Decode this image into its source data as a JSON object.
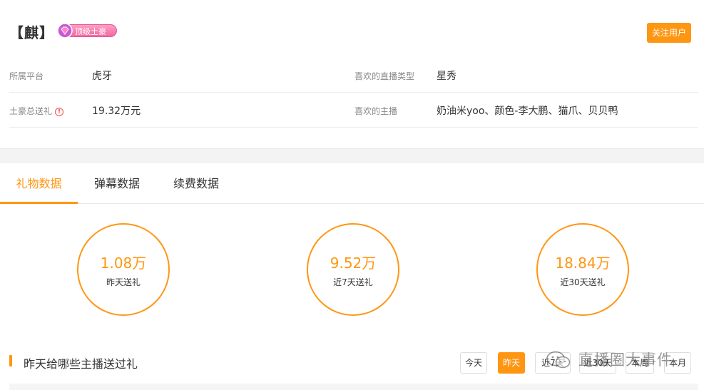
{
  "user": {
    "name": "【麒】",
    "badge_label": "顶级土豪",
    "follow_label": "关注用户"
  },
  "info": {
    "platform_label": "所属平台",
    "platform_value": "虎牙",
    "favorite_type_label": "喜欢的直播类型",
    "favorite_type_value": "星秀",
    "total_gift_label": "土豪总送礼",
    "total_gift_value": "19.32万元",
    "favorite_anchor_label": "喜欢的主播",
    "favorite_anchor_value": "奶油米yoo、颜色-李大鹏、猫爪、贝贝鸭"
  },
  "tabs": [
    {
      "label": "礼物数据",
      "active": true
    },
    {
      "label": "弹幕数据",
      "active": false
    },
    {
      "label": "续费数据",
      "active": false
    }
  ],
  "stats": [
    {
      "value": "1.08万",
      "caption": "昨天送礼"
    },
    {
      "value": "9.52万",
      "caption": "近7天送礼"
    },
    {
      "value": "18.84万",
      "caption": "近30天送礼"
    }
  ],
  "section": {
    "title": "昨天给哪些主播送过礼"
  },
  "ranges": [
    {
      "label": "今天",
      "active": false
    },
    {
      "label": "昨天",
      "active": true
    },
    {
      "label": "近7天",
      "active": false
    },
    {
      "label": "近30天",
      "active": false
    },
    {
      "label": "本周",
      "active": false
    },
    {
      "label": "本月",
      "active": false
    }
  ],
  "watermark": {
    "text": "直播圈大事件",
    "icon": "wechat-icon"
  },
  "colors": {
    "accent": "#ff9612",
    "badge_pink": "#f06aa0",
    "warning": "#f05050"
  }
}
